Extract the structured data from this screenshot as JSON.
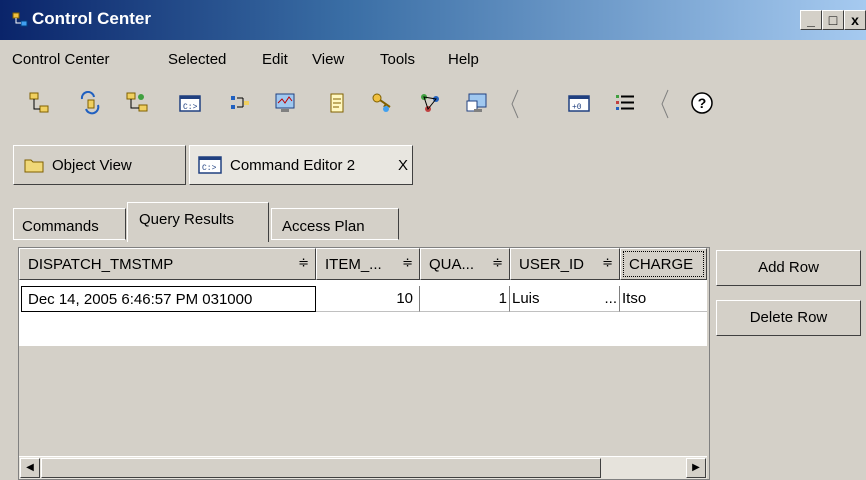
{
  "window": {
    "title": "Control Center",
    "minimize": "_",
    "maximize": "□",
    "close": "x"
  },
  "menu": [
    "Control Center",
    "Selected",
    "Edit",
    "View",
    "Tools",
    "Help"
  ],
  "toolbar": {
    "icons": [
      "object-tree-icon",
      "replication-icon",
      "satellite-icon",
      "command-editor-icon",
      "task-center-icon",
      "health-center-icon",
      "journal-icon",
      "license-center-icon",
      "development-center-icon",
      "configuration-assistant-icon",
      "command-window-icon",
      "list-icon",
      "help-icon"
    ],
    "help_label": "?"
  },
  "doc_tabs": [
    {
      "label": "Object View"
    },
    {
      "label": "Command Editor 2",
      "close": "X"
    }
  ],
  "sub_tabs": [
    "Commands",
    "Query Results",
    "Access Plan"
  ],
  "grid": {
    "columns": [
      "DISPATCH_TMSTMP",
      "ITEM_...",
      "QUA...",
      "USER_ID",
      "CHARGE"
    ],
    "sort_glyph": "≑",
    "rows": [
      {
        "dispatch": "Dec 14, 2005 6:46:57 PM 031000",
        "item": "10",
        "qua": "1",
        "user_id": "Luis",
        "ellipsis": "...",
        "charge": "Itso"
      }
    ]
  },
  "buttons": {
    "add_row": "Add Row",
    "delete_row": "Delete Row"
  },
  "colors": {
    "title_start": "#0a246a",
    "title_end": "#a6caf0",
    "face": "#d4d0c8"
  }
}
